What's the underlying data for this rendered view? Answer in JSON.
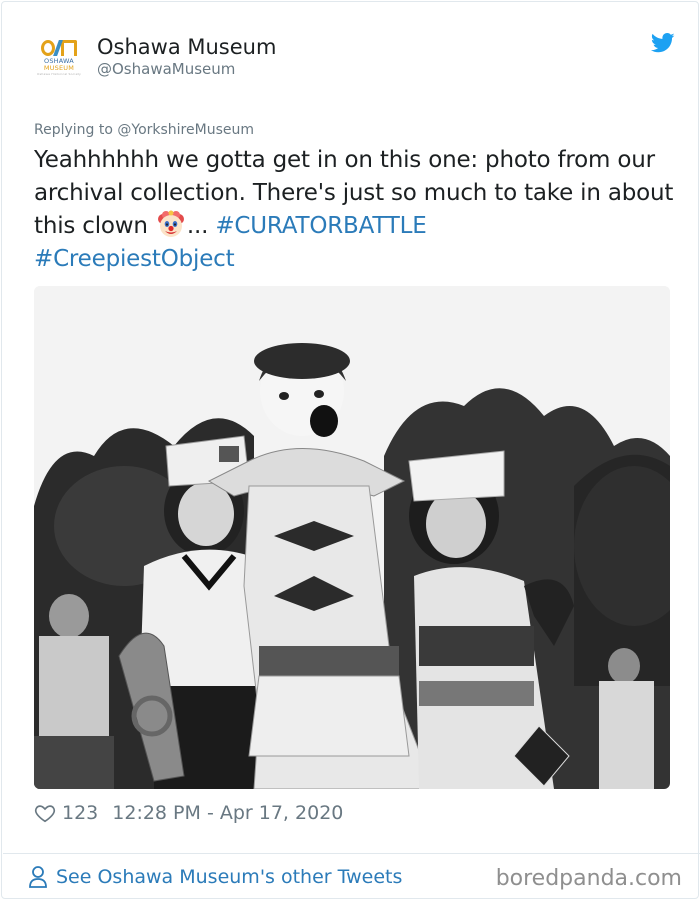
{
  "account": {
    "display_name": "Oshawa Museum",
    "handle": "@OshawaMuseum",
    "logo_text_line1": "OSHAWA",
    "logo_text_line2": "MUSEUM",
    "logo_text_line3": "Oshawa Historical Society"
  },
  "tweet": {
    "replying_to": "Replying to @YorkshireMuseum",
    "text_part1": "Yeahhhhhh we gotta get in on this one: photo from our archival collection. There's just so much to take in about this clown ",
    "text_part2": "... ",
    "hashtag1": "#CURATORBATTLE",
    "hashtag2": "#CreepiestObject",
    "emoji": "clown-face",
    "photo_description": "Black and white archival photo of a smiling clown with two girls in paper hats"
  },
  "meta": {
    "likes": "123",
    "timestamp": "12:28 PM - Apr 17, 2020"
  },
  "footer": {
    "other_tweets_link": "See Oshawa Museum's other Tweets",
    "watermark": "boredpanda.com"
  },
  "colors": {
    "link_blue": "#2b7bb9",
    "twitter_blue": "#1da1f2",
    "muted_text": "#697882",
    "border": "#e1e8ed",
    "logo_orange": "#e3a21a",
    "logo_blue": "#3b6fa4"
  }
}
